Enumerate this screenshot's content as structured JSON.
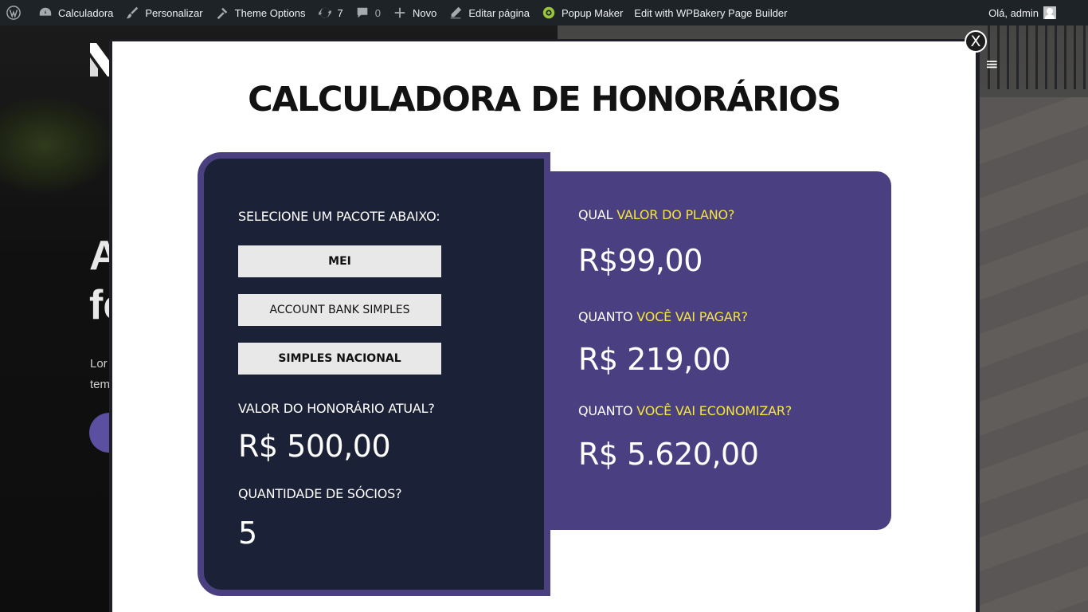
{
  "adminbar": {
    "items": [
      {
        "name": "wp-logo",
        "label": ""
      },
      {
        "name": "site-name",
        "label": "Calculadora"
      },
      {
        "name": "customize",
        "label": "Personalizar"
      },
      {
        "name": "theme-options",
        "label": "Theme Options"
      },
      {
        "name": "updates",
        "label": "7"
      },
      {
        "name": "comments",
        "label": "0"
      },
      {
        "name": "new-content",
        "label": "Novo"
      },
      {
        "name": "edit-page",
        "label": "Editar página"
      },
      {
        "name": "popup-maker",
        "label": "Popup Maker"
      },
      {
        "name": "wpbakery",
        "label": "Edit with WPBakery Page Builder"
      }
    ],
    "greeting": "Olá, admin"
  },
  "site": {
    "hero_partial_1": "A",
    "hero_partial_2": "fe",
    "text_partial_1": "Lor",
    "text_partial_2": "tem"
  },
  "popup": {
    "close_label": "X",
    "title": "CALCULADORA DE HONORÁRIOS",
    "left": {
      "select_label": "SELECIONE UM PACOTE ABAIXO:",
      "packages": [
        "MEI",
        "ACCOUNT BANK SIMPLES",
        "SIMPLES NACIONAL"
      ],
      "current_fee_label": "VALOR DO HONORÁRIO ATUAL?",
      "current_fee_value": "R$ 500,00",
      "partners_label": "QUANTIDADE DE SÓCIOS?",
      "partners_value": "5"
    },
    "right": {
      "plan_prefix": "QUAL ",
      "plan_highlight": "VALOR DO PLANO?",
      "plan_value": "R$99,00",
      "pay_prefix": "QUANTO ",
      "pay_highlight": "VOCÊ VAI PAGAR?",
      "pay_value": "R$ 219,00",
      "save_prefix": "QUANTO ",
      "save_highlight": "VOCÊ VAI ECONOMIZAR?",
      "save_value": "R$ 5.620,00"
    }
  },
  "colors": {
    "adminbar": "#1d2327",
    "dark_card": "#1b2136",
    "purple_card": "#4a4081",
    "highlight": "#f5e63c"
  }
}
